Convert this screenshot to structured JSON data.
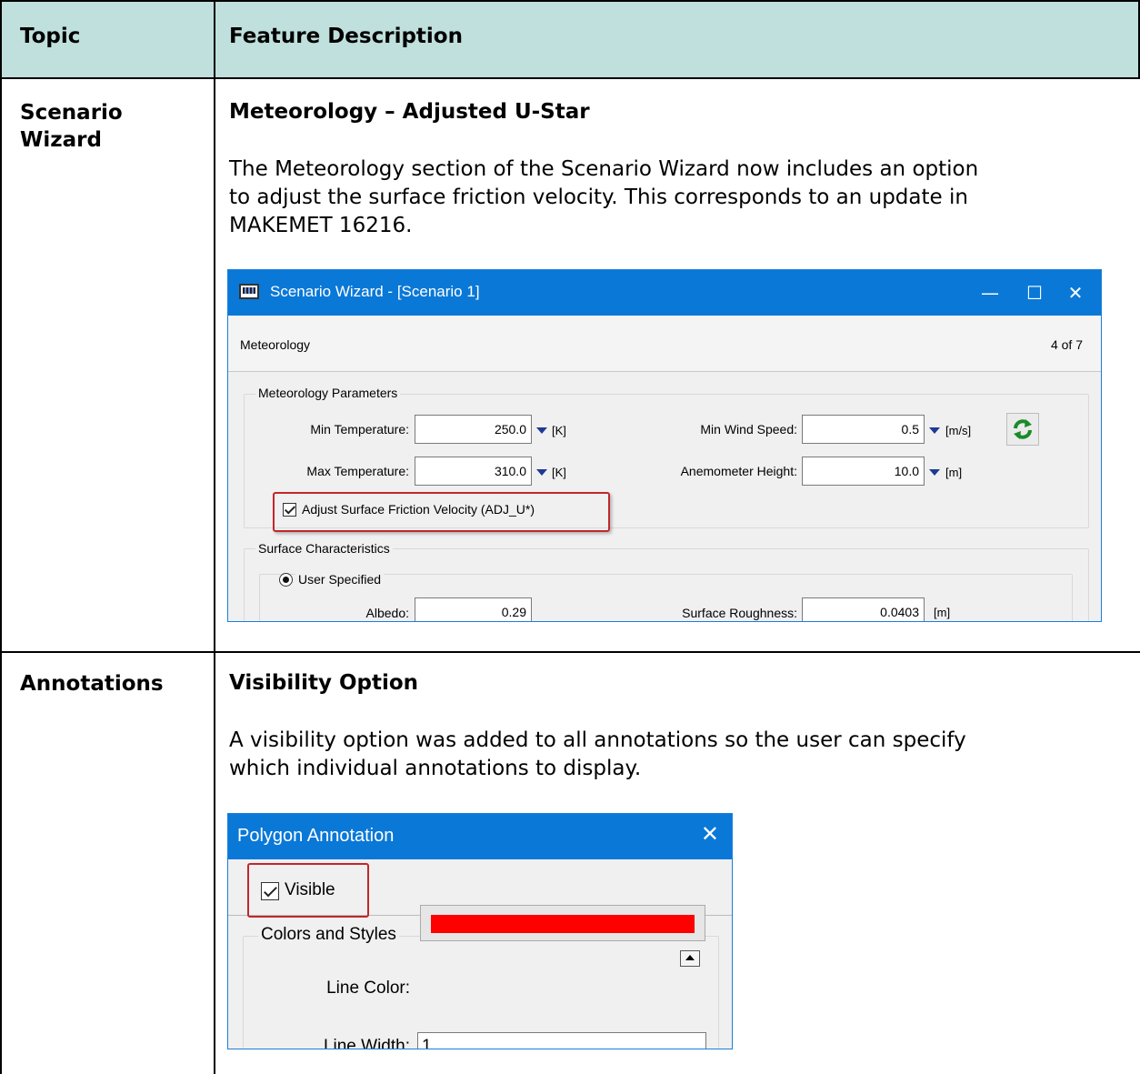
{
  "table": {
    "header": {
      "topic": "Topic",
      "feature": "Feature Description"
    },
    "rows": [
      {
        "topic": [
          "Scenario",
          "Wizard"
        ],
        "title": "Meteorology – Adjusted U-Star",
        "body": [
          "The Meteorology section of the Scenario Wizard now includes an option",
          "to adjust the surface friction velocity. This corresponds to an update in",
          "MAKEMET 16216."
        ]
      },
      {
        "topic": [
          "Annotations"
        ],
        "title": "Visibility Option",
        "body": [
          "A visibility option was added to all annotations so the user can specify",
          "which individual annotations to display."
        ]
      }
    ],
    "header_color": "#bfe0dc"
  },
  "scenario_wizard": {
    "title": "Scenario Wizard - [Scenario 1]",
    "minimize": "—",
    "maximize": "☐",
    "close": "✕",
    "step_name": "Meteorology",
    "step_count": "4 of 7",
    "met_params": {
      "group_label": "Meteorology Parameters",
      "min_temp_label": "Min Temperature:",
      "min_temp_value": "250.0",
      "min_temp_unit": "[K]",
      "max_temp_label": "Max Temperature:",
      "max_temp_value": "310.0",
      "max_temp_unit": "[K]",
      "min_wind_label": "Min Wind Speed:",
      "min_wind_value": "0.5",
      "min_wind_unit": "[m/s]",
      "anem_label": "Anemometer Height:",
      "anem_value": "10.0",
      "anem_unit": "[m]",
      "adjust_label": "Adjust Surface Friction Velocity (ADJ_U*)",
      "adjust_checked": true
    },
    "surface": {
      "group_label": "Surface Characteristics",
      "user_specified_label": "User Specified",
      "albedo_label": "Albedo:",
      "albedo_value": "0.29",
      "roughness_label": "Surface Roughness:",
      "roughness_value": "0.0403",
      "roughness_unit": "[m]"
    },
    "titlebar_color": "#0a78d7",
    "highlight_color": "#c0282c"
  },
  "polygon_annotation": {
    "title": "Polygon Annotation",
    "close": "✕",
    "visible_label": "Visible",
    "visible_checked": true,
    "group_label": "Colors and Styles",
    "line_color_label": "Line Color:",
    "line_color": "#ff0000",
    "line_width_label": "Line Width:",
    "line_width_value": "1"
  }
}
